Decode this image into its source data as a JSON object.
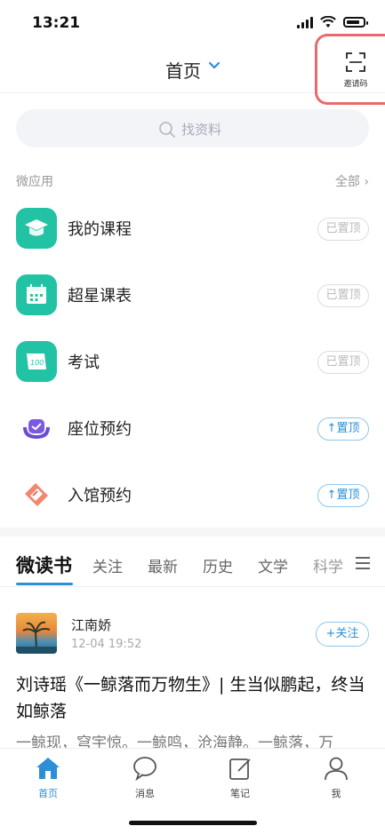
{
  "status_bar": {
    "time": "13:21"
  },
  "header": {
    "title": "首页",
    "invite_label": "邀请码"
  },
  "search": {
    "placeholder": "找资料"
  },
  "micro_apps": {
    "section_title": "微应用",
    "all_label": "全部 ›",
    "items": [
      {
        "name": "我的课程",
        "pin_label": "已置顶",
        "pinned": true,
        "icon": "graduation-cap-icon",
        "color": "#22c3a4"
      },
      {
        "name": "超星课表",
        "pin_label": "已置顶",
        "pinned": true,
        "icon": "calendar-icon",
        "color": "#22c3a4"
      },
      {
        "name": "考试",
        "pin_label": "已置顶",
        "pinned": true,
        "icon": "exam-paper-icon",
        "color": "#22c3a4"
      },
      {
        "name": "座位预约",
        "pin_label": "↑置顶",
        "pinned": false,
        "icon": "seat-icon",
        "color": "#6a4bd6"
      },
      {
        "name": "入馆预约",
        "pin_label": "↑置顶",
        "pinned": false,
        "icon": "ticket-icon",
        "color": "#ef6b5b"
      }
    ]
  },
  "feed_tabs": {
    "items": [
      "微读书",
      "关注",
      "最新",
      "历史",
      "文学",
      "科学"
    ],
    "active": "微读书"
  },
  "post": {
    "author": "江南娇",
    "time": "12-04 19:52",
    "follow_label": "+关注",
    "title": "刘诗瑶《一鲸落而万物生》| 生当似鹏起，终当如鲸落",
    "excerpt": "一鲸现，穹宇惊。一鲸鸣，沧海静。一鲸落，万"
  },
  "bottom_nav": {
    "items": [
      {
        "label": "首页",
        "icon": "home-icon",
        "active": true
      },
      {
        "label": "消息",
        "icon": "message-icon",
        "active": false
      },
      {
        "label": "笔记",
        "icon": "note-icon",
        "active": false
      },
      {
        "label": "我",
        "icon": "profile-icon",
        "active": false
      }
    ]
  },
  "colors": {
    "accent": "#2a8fd6",
    "teal": "#22c3a4",
    "annotation_red": "#e96a6a"
  }
}
